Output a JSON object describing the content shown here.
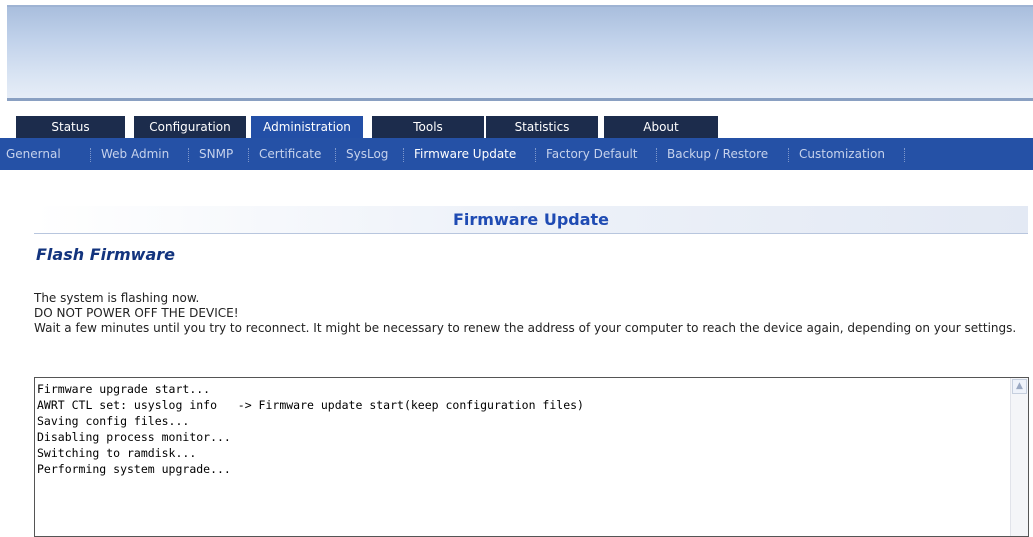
{
  "tabs": [
    {
      "label": "Status"
    },
    {
      "label": "Configuration"
    },
    {
      "label": "Administration",
      "active": true
    },
    {
      "label": "Tools"
    },
    {
      "label": "Statistics"
    },
    {
      "label": "About"
    }
  ],
  "subnav": [
    {
      "label": "Genernal"
    },
    {
      "label": "Web Admin"
    },
    {
      "label": "SNMP"
    },
    {
      "label": "Certificate"
    },
    {
      "label": "SysLog"
    },
    {
      "label": "Firmware Update",
      "active": true
    },
    {
      "label": "Factory Default"
    },
    {
      "label": "Backup / Restore"
    },
    {
      "label": "Customization"
    }
  ],
  "page": {
    "title": "Firmware Update",
    "section": "Flash Firmware",
    "message_line1": "The system is flashing now.",
    "message_line2": "DO NOT POWER OFF THE DEVICE!",
    "message_line3": "Wait a few minutes until you try to reconnect. It might be necessary to renew the address of your computer to reach the device again, depending on your settings."
  },
  "log": {
    "text": "Firmware upgrade start...\nAWRT CTL set: usyslog info   -> Firmware update start(keep configuration files)\nSaving config files...\nDisabling process monitor...\nSwitching to ramdisk...\nPerforming system upgrade..."
  },
  "colors": {
    "tab_bg": "#1c2c4c",
    "tab_active": "#234fa6",
    "subnav_bg": "#2551a6",
    "title": "#1f4bb3"
  }
}
